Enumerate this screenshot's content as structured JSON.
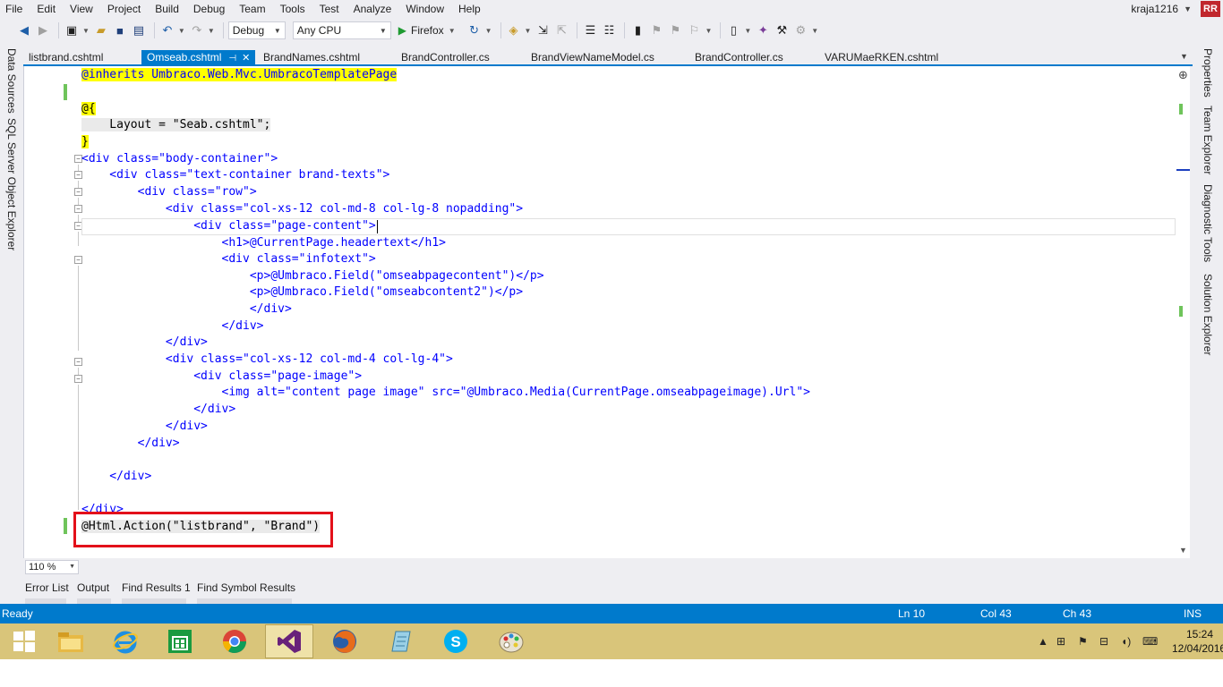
{
  "menu": [
    "File",
    "Edit",
    "View",
    "Project",
    "Build",
    "Debug",
    "Team",
    "Tools",
    "Test",
    "Analyze",
    "Window",
    "Help"
  ],
  "user": {
    "name": "kraja1216",
    "initials": "RR"
  },
  "toolbar": {
    "configuration": "Debug",
    "platform": "Any CPU",
    "run_target": "Firefox"
  },
  "left_tool_tabs": [
    "Data Sources",
    "SQL Server Object Explorer"
  ],
  "right_tool_tabs": [
    "Properties",
    "Team Explorer",
    "Diagnostic Tools",
    "Solution Explorer"
  ],
  "doc_tabs": [
    {
      "label": "listbrand.cshtml",
      "active": false
    },
    {
      "label": "Omseab.cshtml",
      "active": true
    },
    {
      "label": "BrandNames.cshtml",
      "active": false
    },
    {
      "label": "BrandController.cs",
      "active": false
    },
    {
      "label": "BrandViewNameModel.cs",
      "active": false
    },
    {
      "label": "BrandController.cs",
      "active": false
    },
    {
      "label": "VARUMaeRKEN.cshtml",
      "active": false
    }
  ],
  "code_lines": [
    "@inherits Umbraco.Web.Mvc.UmbracoTemplatePage",
    "",
    "@{",
    "    Layout = \"Seab.cshtml\";",
    "}",
    "<div class=\"body-container\">",
    "    <div class=\"text-container brand-texts\">",
    "        <div class=\"row\">",
    "            <div class=\"col-xs-12 col-md-8 col-lg-8 nopadding\">",
    "                <div class=\"page-content\">",
    "                    <h1>@CurrentPage.headertext</h1>",
    "                    <div class=\"infotext\">",
    "                        <p>@Umbraco.Field(\"omseabpagecontent\")</p>",
    "                        <p>@Umbraco.Field(\"omseabcontent2\")</p>",
    "                        </div>",
    "                    </div>",
    "            </div>",
    "            <div class=\"col-xs-12 col-md-4 col-lg-4\">",
    "                <div class=\"page-image\">",
    "                    <img alt=\"content page image\" src=\"@Umbraco.Media(CurrentPage.omseabpageimage).Url\">",
    "                </div>",
    "            </div>",
    "        </div>",
    "",
    "    </div>",
    "",
    "</div>",
    "@Html.Action(\"listbrand\", \"Brand\")"
  ],
  "zoom": "110 %",
  "bottom_tabs": [
    "Error List",
    "Output",
    "Find Results 1",
    "Find Symbol Results"
  ],
  "status": {
    "text": "Ready",
    "line": "Ln 10",
    "col": "Col 43",
    "ch": "Ch 43",
    "mode": "INS"
  },
  "taskbar": {
    "apps": [
      "start-icon",
      "file-explorer-icon",
      "internet-explorer-icon",
      "store-icon",
      "chrome-icon",
      "visual-studio-icon",
      "firefox-icon",
      "notepad-icon",
      "skype-icon",
      "paint-icon"
    ],
    "time": "15:24",
    "date": "12/04/2016"
  },
  "colors": {
    "accent": "#007acc",
    "highlight_box": "#e3101a",
    "taskbar": "#d9c57a"
  }
}
